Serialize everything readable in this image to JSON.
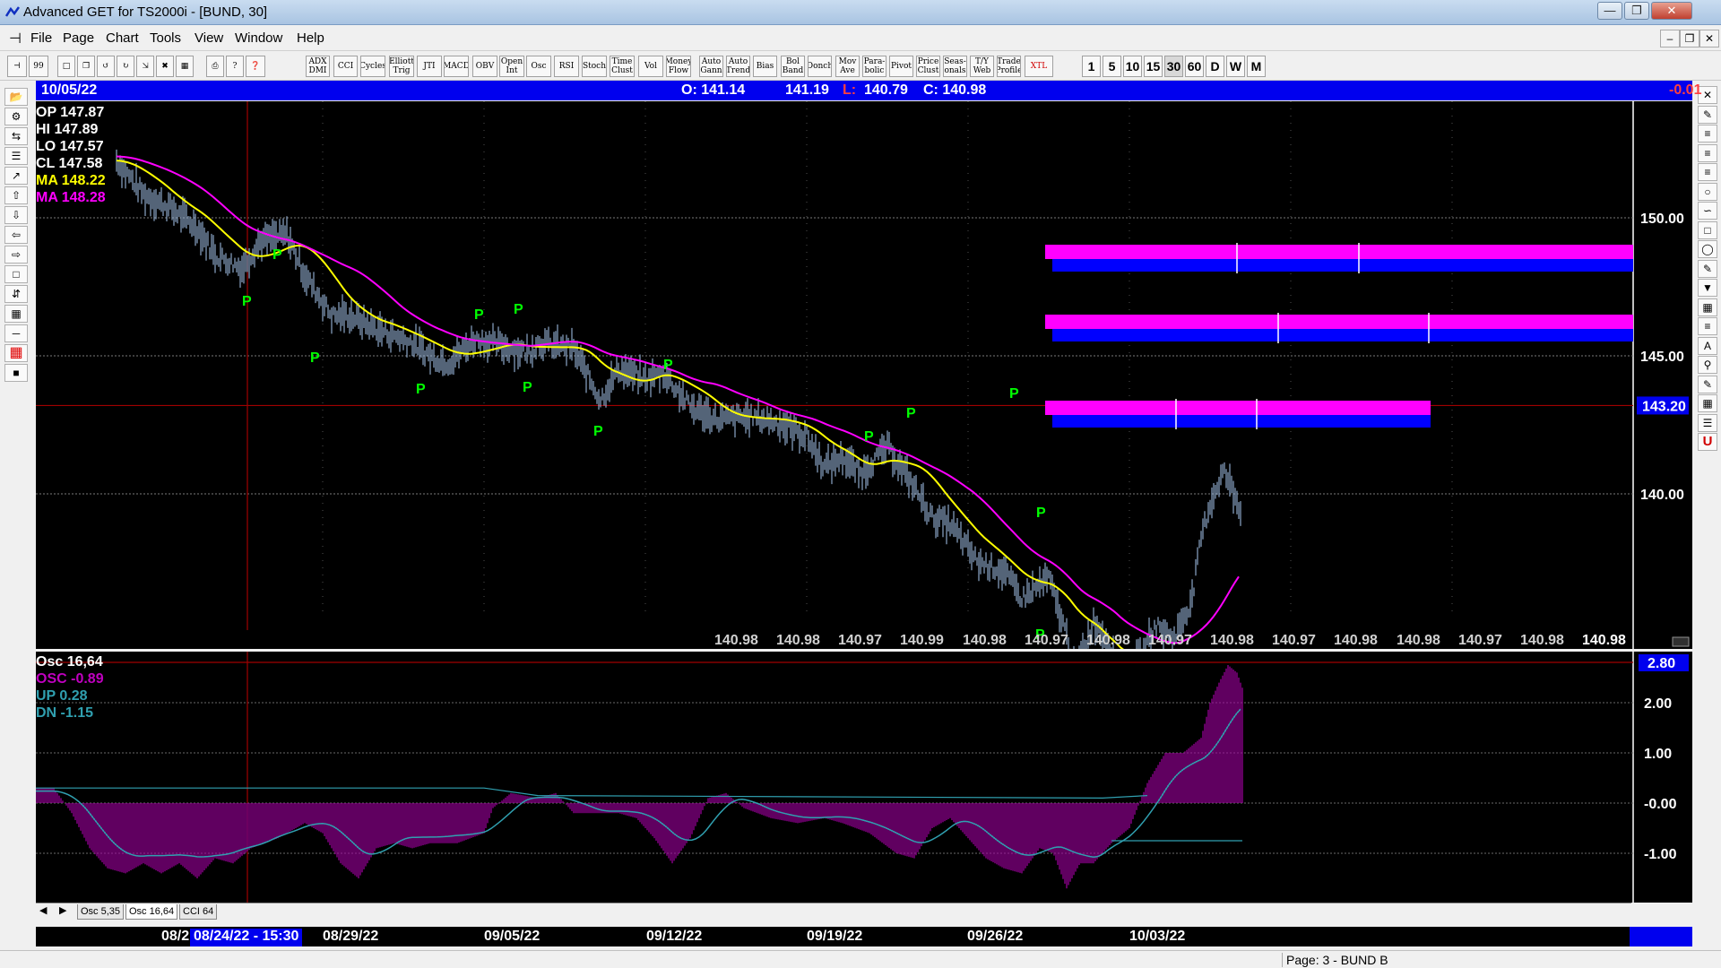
{
  "window": {
    "title": "Advanced GET for TS2000i - [BUND, 30]"
  },
  "menu": [
    "File",
    "Page",
    "Chart",
    "Tools",
    "View",
    "Window",
    "Help"
  ],
  "toolbar": {
    "study_buttons": [
      "ADX DMI",
      "CCI",
      "Cycles",
      "Elliott Trig",
      "JTI",
      "MACD",
      "OBV",
      "Open Int",
      "Osc",
      "RSI",
      "Stoch",
      "Time Clust",
      "Vol",
      "Money Flow",
      "Auto Gann",
      "Auto Trend",
      "Bias",
      "Bol Band",
      "Donch",
      "Mov Ave",
      "Para- bolic",
      "Pivot",
      "Price Clust",
      "Seas- onals",
      "T/Y Web",
      "Trade Profile",
      "XTL"
    ],
    "intervals": [
      "1",
      "5",
      "10",
      "15",
      "30",
      "60",
      "D",
      "W",
      "M"
    ],
    "active_interval": "30"
  },
  "left_tools": [
    "open",
    "reset",
    "study",
    "Elliott",
    "up",
    "down",
    "left",
    "right",
    "fib",
    "grid",
    "LINES",
    "GANN",
    "FIB",
    "cross",
    "print"
  ],
  "right_tools": [
    "X",
    "pen",
    "FIB RET",
    "FIB EXT",
    "FIB TIME",
    "circle",
    "fan",
    "box",
    "ELLIPS",
    "tool",
    "PTI",
    "grid",
    "MOB",
    "A",
    "zoom",
    "paint",
    "calc",
    "list",
    "U"
  ],
  "infobar": {
    "date": "10/05/22",
    "open": "O: 141.14",
    "high": "141.19",
    "low_label": "L:",
    "low": "140.79",
    "close": "C: 140.98",
    "change": "-0.01"
  },
  "main_legend": {
    "op": "OP 147.87",
    "hi": "HI  147.89",
    "lo": "LO  147.57",
    "cl": "CL  147.58",
    "ma1": "MA  148.22",
    "ma2": "MA  148.28"
  },
  "price_axis": {
    "labels": [
      "150.00",
      "145.00",
      "140.00"
    ],
    "values": [
      150,
      145,
      140
    ],
    "current": "143.20",
    "current_value": 143.2
  },
  "bottom_prices": [
    "140.98",
    "140.98",
    "140.97",
    "140.99",
    "140.98",
    "140.97",
    "140.98",
    "140.97",
    "140.98",
    "140.97",
    "140.98",
    "140.98",
    "140.97",
    "140.98",
    "140.98"
  ],
  "pivot_label": "P",
  "osc_legend": {
    "title": "Osc 16,64",
    "osc": "OSC -0.89",
    "up": "UP   0.28",
    "dn": "DN   -1.15"
  },
  "osc_axis": {
    "labels": [
      "2.00",
      "1.00",
      "-0.00",
      "-1.00"
    ],
    "values": [
      2,
      1,
      0,
      -1
    ],
    "current": "2.80"
  },
  "tabs": [
    "Osc 5,35",
    "Osc 16,64",
    "CCI 64"
  ],
  "active_tab": "Osc 16,64",
  "dates": {
    "cut": "08/2",
    "cursor": "08/24/22 - 15:30",
    "labels": [
      "08/29/22",
      "09/05/22",
      "09/12/22",
      "09/19/22",
      "09/26/22",
      "10/03/22"
    ]
  },
  "status": {
    "page": "Page: 3 - BUND B"
  },
  "colors": {
    "price": "#a8c8f0",
    "ma_fast": "#ffff00",
    "ma_slow": "#ff00ff",
    "pivot": "#00ff00",
    "zone_top": "#ff00ff",
    "zone_bottom": "#0000ff",
    "infobar": "#0000ee",
    "cursor": "#a00000",
    "osc_hist": "#a000a0",
    "osc_line": "#30a0b0"
  }
}
